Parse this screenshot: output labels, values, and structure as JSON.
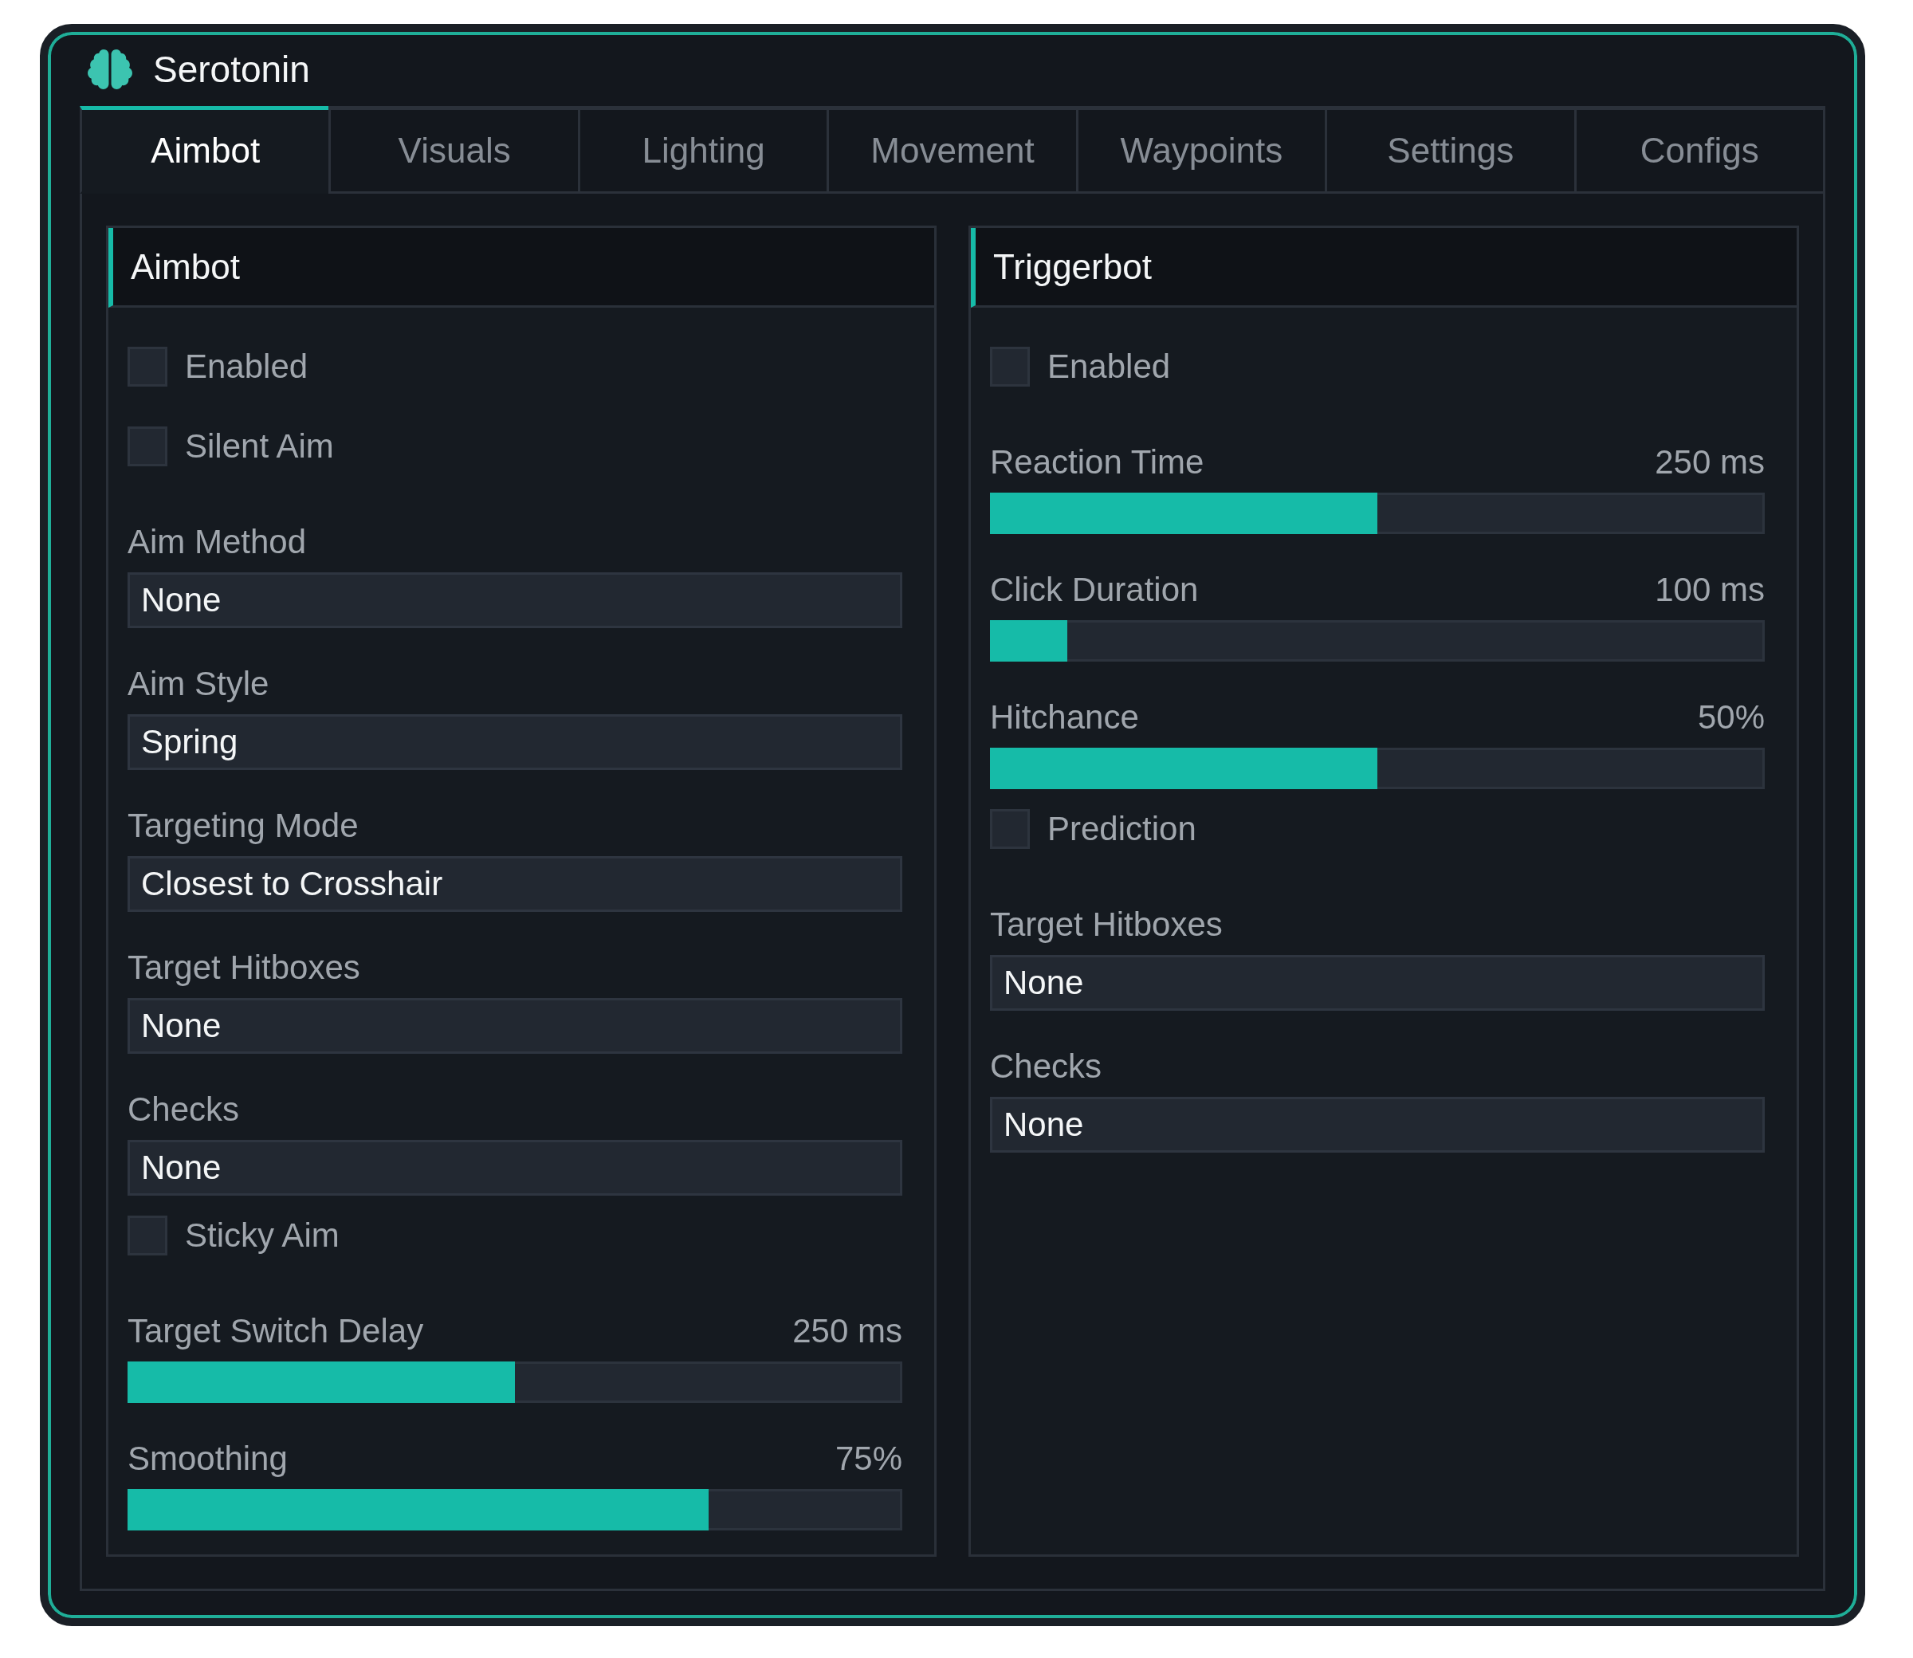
{
  "window": {
    "title": "Serotonin"
  },
  "tabs": [
    {
      "label": "Aimbot",
      "selected": true
    },
    {
      "label": "Visuals",
      "selected": false
    },
    {
      "label": "Lighting",
      "selected": false
    },
    {
      "label": "Movement",
      "selected": false
    },
    {
      "label": "Waypoints",
      "selected": false
    },
    {
      "label": "Settings",
      "selected": false
    },
    {
      "label": "Configs",
      "selected": false
    }
  ],
  "panels": [
    {
      "title": "Aimbot",
      "controls": [
        {
          "kind": "checkbox",
          "label": "Enabled",
          "checked": false
        },
        {
          "kind": "checkbox",
          "label": "Silent Aim",
          "checked": false
        },
        {
          "kind": "dropdown",
          "label": "Aim Method",
          "value": "None"
        },
        {
          "kind": "dropdown",
          "label": "Aim Style",
          "value": "Spring"
        },
        {
          "kind": "dropdown",
          "label": "Targeting Mode",
          "value": "Closest to Crosshair"
        },
        {
          "kind": "dropdown",
          "label": "Target Hitboxes",
          "value": "None"
        },
        {
          "kind": "dropdown",
          "label": "Checks",
          "value": "None"
        },
        {
          "kind": "checkbox",
          "label": "Sticky Aim",
          "checked": false
        },
        {
          "kind": "slider",
          "label": "Target Switch Delay",
          "reading": "250 ms",
          "level": 0.5
        },
        {
          "kind": "slider",
          "label": "Smoothing",
          "reading": "75%",
          "level": 0.75
        }
      ]
    },
    {
      "title": "Triggerbot",
      "controls": [
        {
          "kind": "checkbox",
          "label": "Enabled",
          "checked": false
        },
        {
          "kind": "slider",
          "label": "Reaction Time",
          "reading": "250 ms",
          "level": 0.5
        },
        {
          "kind": "slider",
          "label": "Click Duration",
          "reading": "100 ms",
          "level": 0.1
        },
        {
          "kind": "slider",
          "label": "Hitchance",
          "reading": "50%",
          "level": 0.5
        },
        {
          "kind": "checkbox",
          "label": "Prediction",
          "checked": false
        },
        {
          "kind": "dropdown",
          "label": "Target Hitboxes",
          "value": "None"
        },
        {
          "kind": "dropdown",
          "label": "Checks",
          "value": "None"
        }
      ]
    }
  ]
}
